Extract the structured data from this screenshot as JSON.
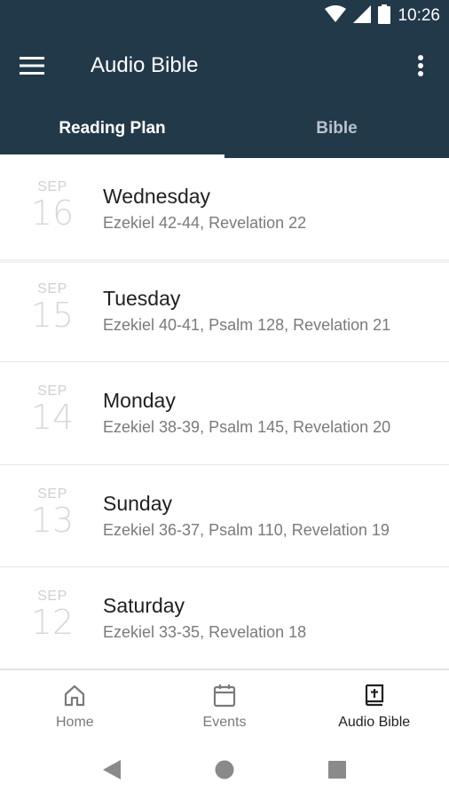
{
  "status_bar": {
    "time": "10:26",
    "icons": [
      "wifi-icon",
      "signal-icon",
      "battery-icon"
    ]
  },
  "app_bar": {
    "title": "Audio Bible",
    "menu_icon": "hamburger-menu-icon",
    "overflow_icon": "more-vertical-icon"
  },
  "tabs": [
    {
      "label": "Reading Plan",
      "active": true
    },
    {
      "label": "Bible",
      "active": false
    }
  ],
  "reading_plan": [
    {
      "month": "SEP",
      "day": "16",
      "weekday": "Wednesday",
      "passages": "Ezekiel 42-44, Revelation 22"
    },
    {
      "month": "SEP",
      "day": "15",
      "weekday": "Tuesday",
      "passages": "Ezekiel 40-41, Psalm 128, Revelation 21"
    },
    {
      "month": "SEP",
      "day": "14",
      "weekday": "Monday",
      "passages": "Ezekiel 38-39, Psalm 145, Revelation 20"
    },
    {
      "month": "SEP",
      "day": "13",
      "weekday": "Sunday",
      "passages": "Ezekiel 36-37, Psalm 110, Revelation 19"
    },
    {
      "month": "SEP",
      "day": "12",
      "weekday": "Saturday",
      "passages": "Ezekiel 33-35, Revelation 18"
    }
  ],
  "bottom_nav": [
    {
      "label": "Home",
      "icon": "home-icon",
      "active": false
    },
    {
      "label": "Events",
      "icon": "calendar-icon",
      "active": false
    },
    {
      "label": "Audio Bible",
      "icon": "bible-icon",
      "active": true
    }
  ],
  "system_nav": [
    "back-icon",
    "home-circle-icon",
    "recents-icon"
  ],
  "colors": {
    "header_bg": "#22394a",
    "active_text": "#212121",
    "muted_text": "#7a7a7a"
  }
}
